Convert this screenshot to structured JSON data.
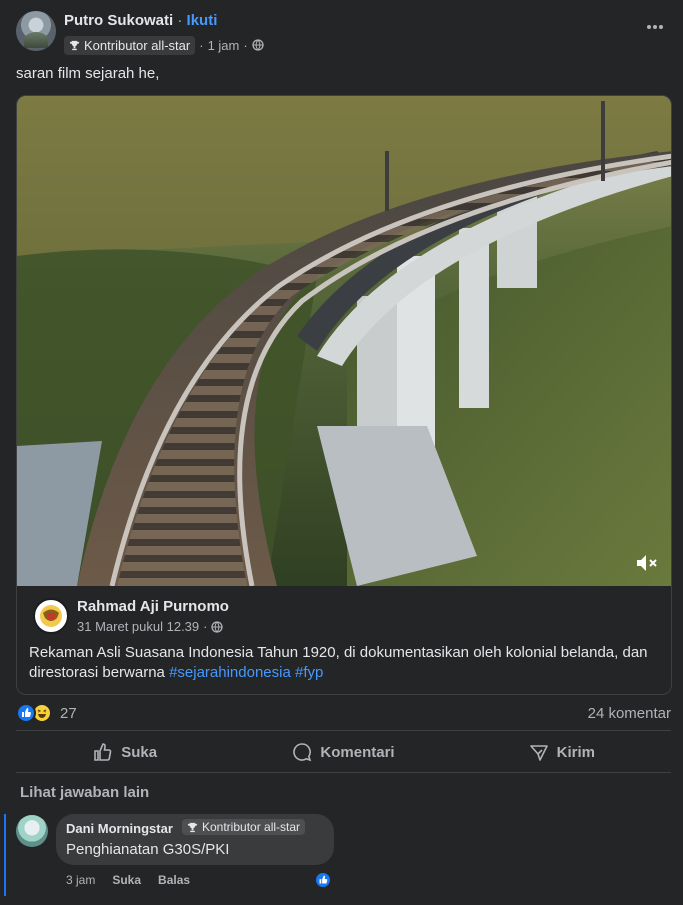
{
  "post": {
    "author": "Putro Sukowati",
    "separator": "·",
    "follow_label": "Ikuti",
    "badge": "Kontributor all-star",
    "time": "1 jam",
    "meta_dot": "·",
    "text": "saran film sejarah he,"
  },
  "shared": {
    "author": "Rahmad Aji Purnomo",
    "date": "31 Maret pukul 12.39",
    "meta_dot": "·",
    "caption": "Rekaman Asli Suasana Indonesia Tahun 1920, di dokumentasikan oleh kolonial belanda, dan direstorasi berwarna ",
    "hashtag1": "#sejarahindonesia",
    "hashtag2": "#fyp"
  },
  "stats": {
    "reactions": "27",
    "comments": "24 komentar"
  },
  "actions": {
    "like": "Suka",
    "comment": "Komentari",
    "share": "Kirim"
  },
  "more_replies": "Lihat jawaban lain",
  "comment": {
    "author": "Dani Morningstar",
    "badge": "Kontributor all-star",
    "text": "Penghianatan G30S/PKI",
    "time": "3 jam",
    "like": "Suka",
    "reply": "Balas"
  },
  "icons": {
    "more": "more-horizontal-icon",
    "globe": "globe-icon",
    "trophy": "trophy-icon",
    "mute": "speaker-muted-icon",
    "like": "thumbs-up-icon",
    "comment": "speech-bubble-icon",
    "share": "send-icon"
  },
  "colors": {
    "background": "#242526",
    "link": "#4599ff",
    "like_blue": "#1877f2",
    "muted_text": "#b0b3b8"
  }
}
